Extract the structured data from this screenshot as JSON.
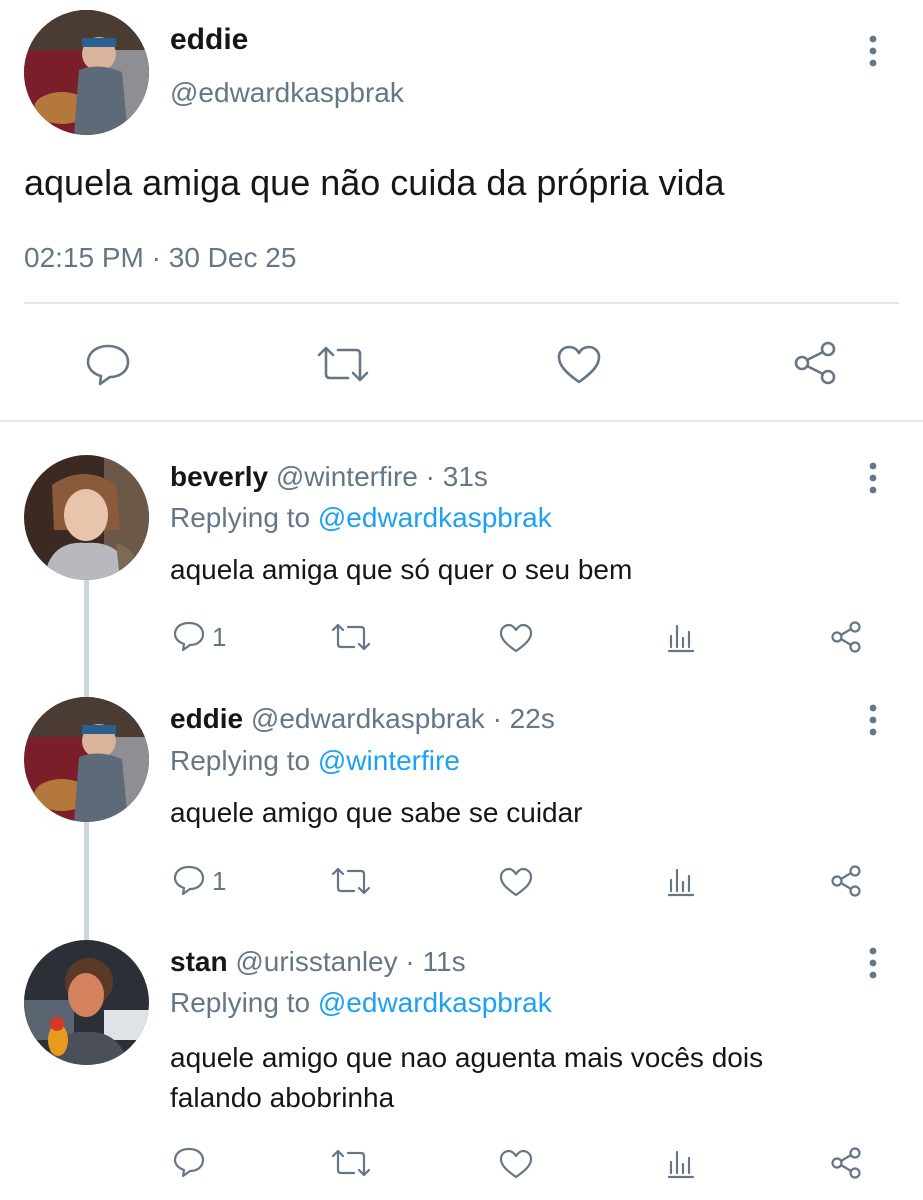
{
  "main_tweet": {
    "name": "eddie",
    "handle": "@edwardkaspbrak",
    "text": "aquela amiga que não cuida da própria vida",
    "time": "02:15 PM",
    "separator": "·",
    "date": "30 Dec 25"
  },
  "icons": {
    "reply": "reply-icon",
    "retweet": "retweet-icon",
    "like": "heart-icon",
    "share": "share-icon",
    "analytics": "analytics-icon",
    "more": "more-options-icon"
  },
  "replying_to_label": "Replying to",
  "replies": [
    {
      "name": "beverly",
      "handle": "@winterfire",
      "time": "· 31s",
      "replying_to": "@edwardkaspbrak",
      "text": "aquela amiga que só quer o seu bem",
      "reply_count": "1"
    },
    {
      "name": "eddie",
      "handle": "@edwardkaspbrak",
      "time": "· 22s",
      "replying_to": "@winterfire",
      "text": "aquele amigo que sabe se cuidar",
      "reply_count": "1"
    },
    {
      "name": "stan",
      "handle": "@urisstanley",
      "time": "· 11s",
      "replying_to": "@edwardkaspbrak",
      "text_line1": "aquele amigo que nao aguenta mais vocês dois",
      "text_line2": "falando abobrinha",
      "reply_count": ""
    }
  ],
  "colors": {
    "link": "#1da1f2",
    "muted": "#657786",
    "text": "#14171a",
    "divider": "#e1e8ed"
  }
}
